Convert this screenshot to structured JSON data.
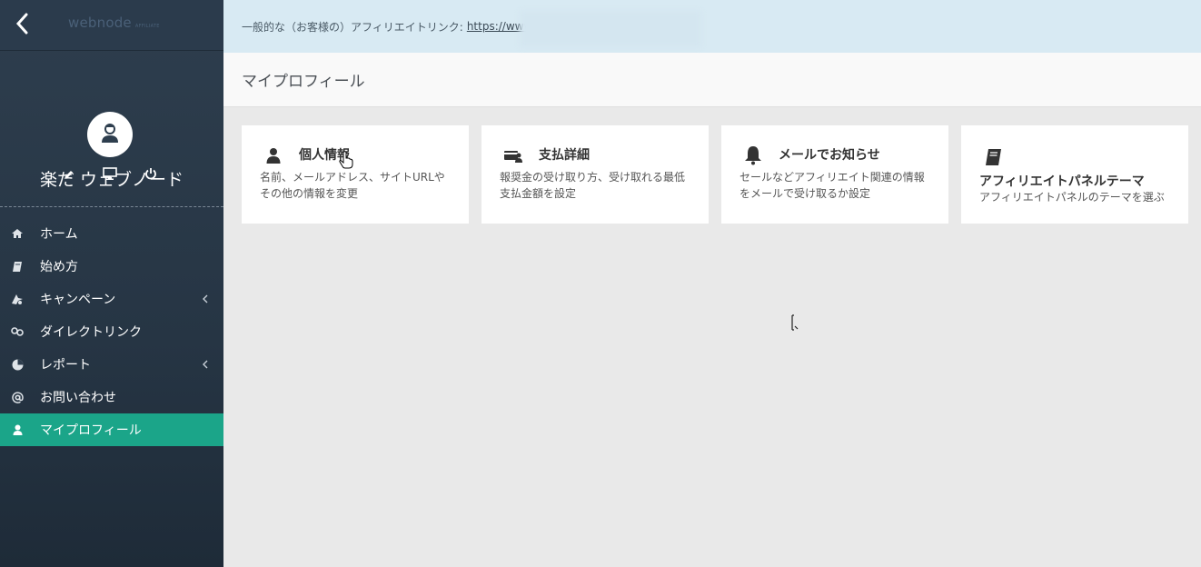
{
  "sidebar": {
    "logo_main": "webnode",
    "logo_sub": "AFFILIATE",
    "user_name": "楽だ ウェブノード",
    "nav": [
      {
        "label": "ホーム",
        "icon": "home-icon"
      },
      {
        "label": "始め方",
        "icon": "book-icon"
      },
      {
        "label": "キャンペーン",
        "icon": "campaign-icon"
      },
      {
        "label": "ダイレクトリンク",
        "icon": "link-icon"
      },
      {
        "label": "レポート",
        "icon": "chart-icon"
      },
      {
        "label": "お問い合わせ",
        "icon": "at-icon"
      },
      {
        "label": "マイプロフィール",
        "icon": "user-icon"
      }
    ]
  },
  "affiliate_bar": {
    "label": "一般的な（お客様の）アフィリエイトリンク:",
    "link": "https://www."
  },
  "page": {
    "title": "マイプロフィール"
  },
  "cards": [
    {
      "title": "個人情報",
      "desc": "名前、メールアドレス、サイトURLや その他の情報を変更",
      "icon": "person-icon"
    },
    {
      "title": "支払詳細",
      "desc": "報奨金の受け取り方、受け取れる最低 支払金額を設定",
      "icon": "payment-card-icon"
    },
    {
      "title": "メールでお知らせ",
      "desc": "セールなどアフィリエイト関連の情報 をメールで受け取るか設定",
      "icon": "bell-icon"
    },
    {
      "title": "アフィリエイトパネルテーマ",
      "desc": "アフィリエイトパネルのテーマを選ぶ",
      "icon": "notebook-icon"
    }
  ],
  "colors": {
    "sidebar_bg": "#2e3e4e",
    "active": "#1ba589",
    "affiliate_bar_bg": "#d8eaf3"
  }
}
